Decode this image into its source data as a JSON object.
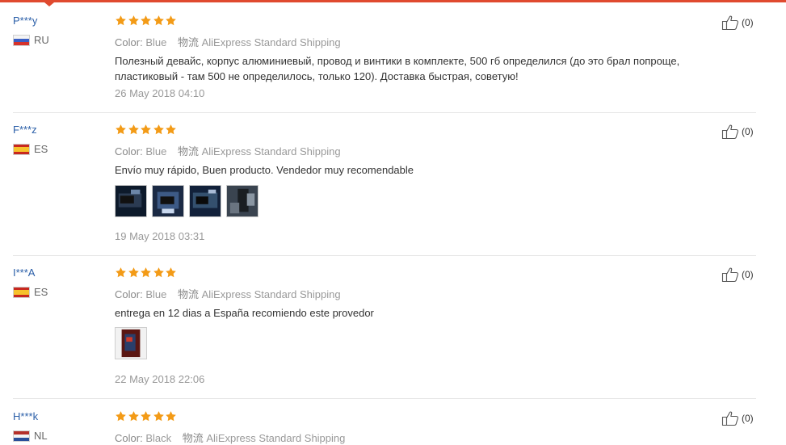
{
  "labels": {
    "color": "Color:",
    "shipping_cn": "物流"
  },
  "reviews": [
    {
      "user": "P***y",
      "country": "RU",
      "flag": "ru",
      "rating": 5,
      "color": "Blue",
      "shipping": "AliExpress Standard Shipping",
      "text": "Полезный девайс, корпус алюминиевый, провод и винтики в комплекте, 500 гб определился (до это брал попроще, пластиковый - там 500 не определилось, только 120). Доставка быстрая, советую!",
      "photos": [],
      "date": "26 May 2018 04:10",
      "useful": "(0)"
    },
    {
      "user": "F***z",
      "country": "ES",
      "flag": "es",
      "rating": 5,
      "color": "Blue",
      "shipping": "AliExpress Standard Shipping",
      "text": "Envío muy rápido, Buen producto. Vendedor muy recomendable",
      "photos": [
        "photo-1",
        "photo-2",
        "photo-3",
        "photo-4"
      ],
      "date": "19 May 2018 03:31",
      "useful": "(0)"
    },
    {
      "user": "I***A",
      "country": "ES",
      "flag": "es",
      "rating": 5,
      "color": "Blue",
      "shipping": "AliExpress Standard Shipping",
      "text": "entrega en 12 dias a España recomiendo este provedor",
      "photos": [
        "photo-1"
      ],
      "date": "22 May 2018 22:06",
      "useful": "(0)"
    },
    {
      "user": "H***k",
      "country": "NL",
      "flag": "nl",
      "rating": 5,
      "color": "Black",
      "shipping": "AliExpress Standard Shipping",
      "text": "",
      "photos": [],
      "date": "",
      "useful": "(0)"
    }
  ],
  "colors": {
    "accent": "#e04a2f",
    "star": "#f39b17",
    "username": "#2b5fa8"
  }
}
